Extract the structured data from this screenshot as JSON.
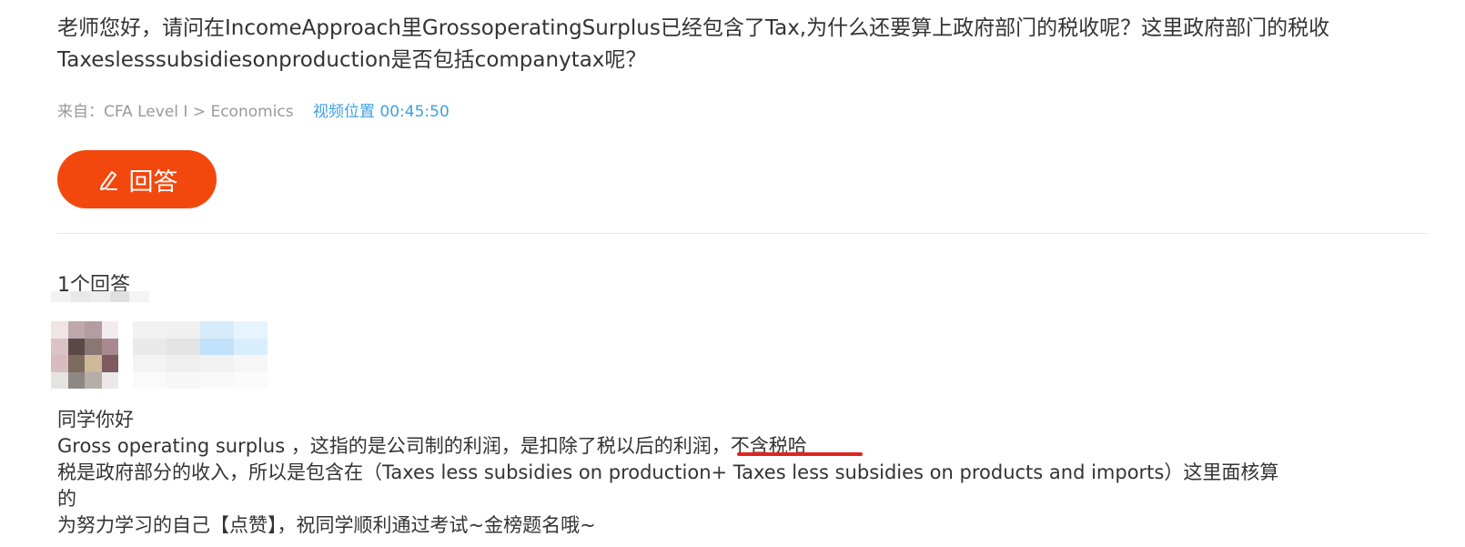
{
  "question": {
    "text": "老师您好，请问在IncomeApproach里GrossoperatingSurplus已经包含了Tax,为什么还要算上政府部门的税收呢？这里政府部门的税收Taxeslesssubsidiesonproduction是否包括companytax呢？"
  },
  "meta": {
    "source": "来自：CFA Level I > Economics",
    "video_position": "视频位置 00:45:50"
  },
  "answer_button": {
    "label": "回答",
    "icon": "pen-icon",
    "color": "#f2480e"
  },
  "answers": {
    "count_label": "1个回答",
    "items": [
      {
        "avatar_icon": "blurred-avatar",
        "lines": [
          "同学你好",
          "Gross operating surplus ，这指的是公司制的利润，是扣除了税以后的利润，不含税哈",
          "税是政府部分的收入，所以是包含在（Taxes less subsidies on production+ Taxes less subsidies on products and imports）这里面核算的",
          "为努力学习的自己【点赞】，祝同学顺利通过考试~金榜题名哦~"
        ]
      }
    ]
  },
  "colors": {
    "accent": "#f2480e",
    "link": "#3ea0e0",
    "muted": "#999999",
    "highlight_underline": "#e0251d"
  }
}
